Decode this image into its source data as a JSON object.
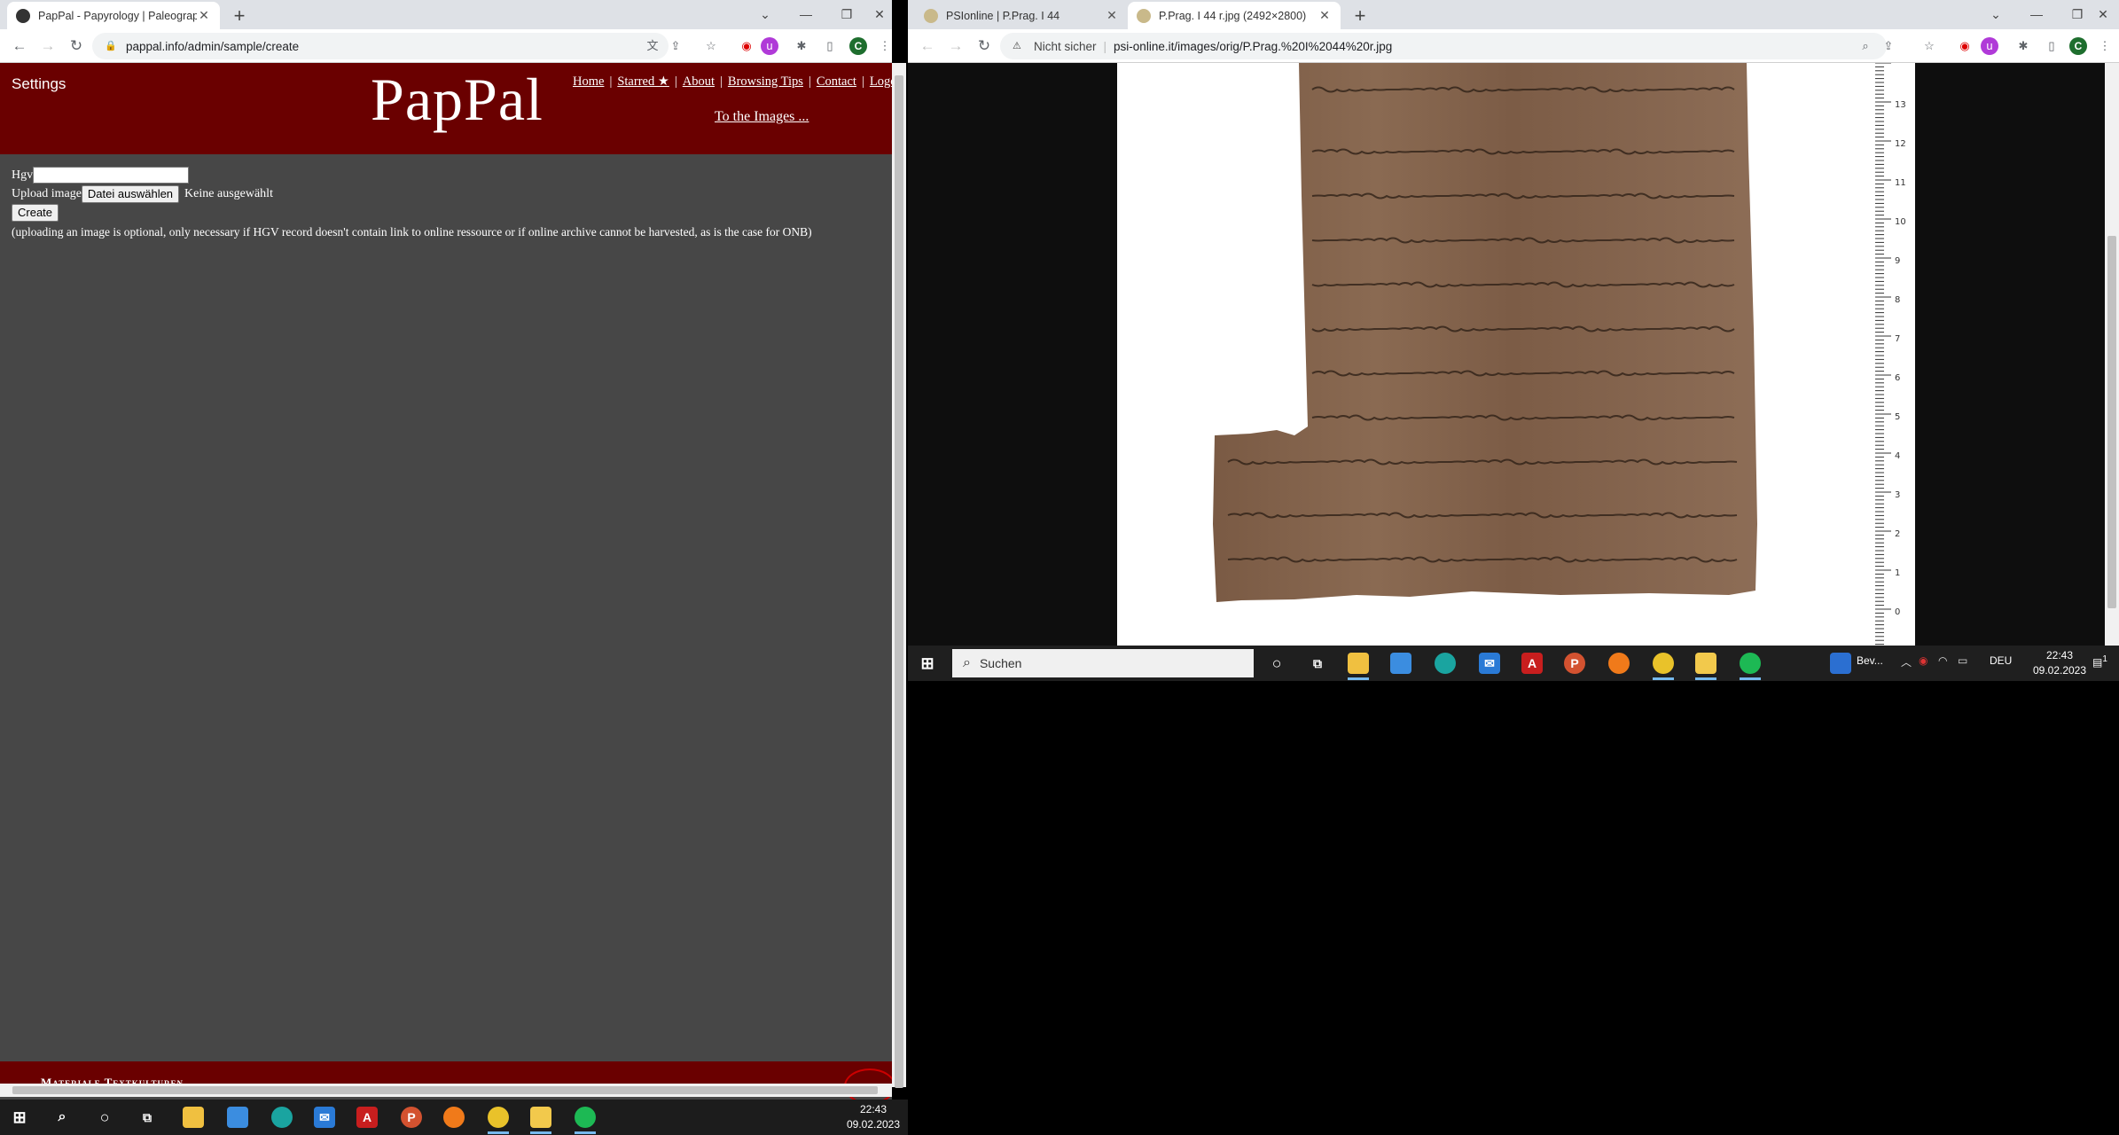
{
  "left_window": {
    "tab": {
      "title": "PapPal - Papyrology | Paleograph"
    },
    "address": "pappal.info/admin/sample/create",
    "page": {
      "settings_label": "Settings",
      "logo": "PapPal",
      "nav": [
        {
          "label": "Home"
        },
        {
          "label": "Starred ★"
        },
        {
          "label": "About"
        },
        {
          "label": "Browsing Tips"
        },
        {
          "label": "Contact"
        },
        {
          "label": "Logou"
        }
      ],
      "to_images": "To the Images ...",
      "form": {
        "hgv_label": "Hgv",
        "hgv_value": "",
        "upload_label": "Upload image",
        "file_button": "Datei auswählen",
        "file_status": "Keine ausgewählt",
        "create_button": "Create",
        "note": "(uploading an image is optional, only necessary if HGV record doesn't contain link to online ressource or if online archive cannot be harvested, as is the case for ONB)"
      },
      "footer_text": "Materiale Textkulturen"
    }
  },
  "right_window": {
    "tabs": [
      {
        "title": "PSIonline | P.Prag. I 44"
      },
      {
        "title": "P.Prag. I 44 r.jpg (2492×2800)"
      }
    ],
    "security_label": "Nicht sicher",
    "address": "psi-online.it/images/orig/P.Prag.%20I%2044%20r.jpg",
    "ruler_numbers": [
      "13",
      "12",
      "11",
      "10",
      "9",
      "8",
      "7",
      "6",
      "5",
      "4",
      "3",
      "2",
      "1",
      "0"
    ]
  },
  "taskbar_right": {
    "search_placeholder": "Suchen",
    "doc_label": "Bev...",
    "lang": "DEU",
    "time": "22:43",
    "date": "09.02.2023",
    "notification_count": "1"
  },
  "taskbar_left": {
    "time": "22:43",
    "date": "09.02.2023"
  }
}
